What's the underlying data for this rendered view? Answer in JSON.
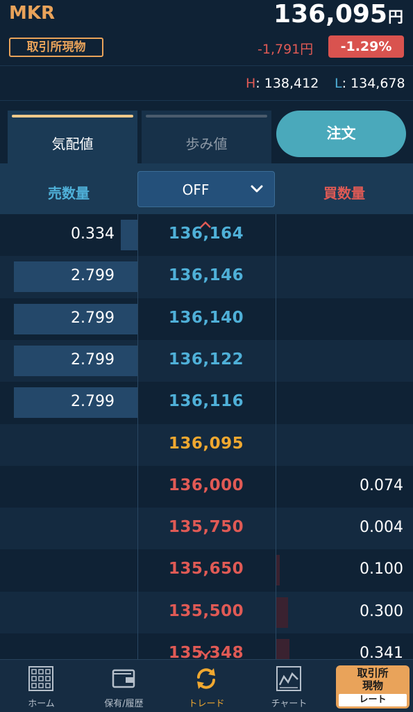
{
  "header": {
    "symbol": "MKR",
    "exchange_badge": "取引所現物",
    "price": "136,095",
    "price_unit": "円",
    "change": "-1,791円",
    "change_pct": "-1.29%"
  },
  "high_low": {
    "high_label": "H",
    "high_value": ": 138,412",
    "low_label": "L",
    "low_value": ": 134,678"
  },
  "tabs": {
    "quote": "気配値",
    "trades": "歩み値",
    "order_button": "注文"
  },
  "columns": {
    "ask_header": "売数量",
    "bid_header": "買数量",
    "filter_value": "OFF"
  },
  "book": {
    "asks": [
      {
        "qty": "0.334",
        "price": "136,164",
        "bar_fraction": 0.12
      },
      {
        "qty": "2.799",
        "price": "136,146",
        "bar_fraction": 0.9
      },
      {
        "qty": "2.799",
        "price": "136,140",
        "bar_fraction": 0.9
      },
      {
        "qty": "2.799",
        "price": "136,122",
        "bar_fraction": 0.9
      },
      {
        "qty": "2.799",
        "price": "136,116",
        "bar_fraction": 0.9
      }
    ],
    "current": {
      "price": "136,095"
    },
    "bids": [
      {
        "qty": "0.074",
        "price": "136,000",
        "bar_fraction": 0.0
      },
      {
        "qty": "0.004",
        "price": "135,750",
        "bar_fraction": 0.0
      },
      {
        "qty": "0.100",
        "price": "135,650",
        "bar_fraction": 0.03
      },
      {
        "qty": "0.300",
        "price": "135,500",
        "bar_fraction": 0.09
      },
      {
        "qty": "0.341",
        "price": "135,348",
        "bar_fraction": 0.1
      }
    ]
  },
  "nav": {
    "home": "ホーム",
    "holdings": "保有/履歴",
    "trade": "トレード",
    "chart": "チャート",
    "rate_top": "取引所\n現物",
    "rate_bottom": "レート"
  },
  "colors": {
    "accent": "#e9a35a",
    "ask": "#4fb0d8",
    "bid": "#e05a55",
    "current": "#f0a830",
    "order_button": "#4aa9bb"
  }
}
